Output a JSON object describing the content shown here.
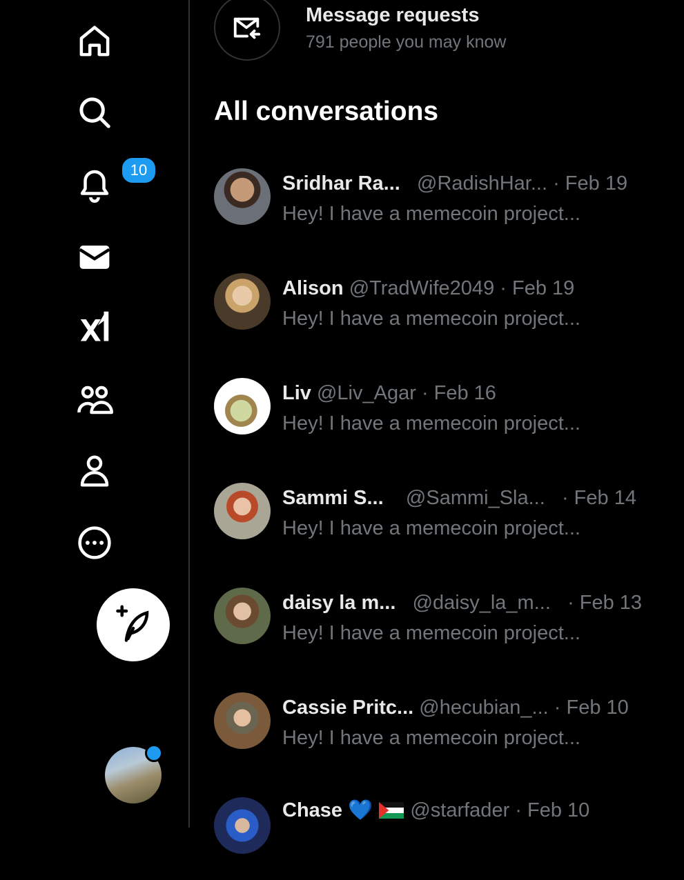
{
  "notifications_badge": "10",
  "message_requests": {
    "title": "Message requests",
    "subtitle": "791 people you may know"
  },
  "section_title": "All conversations",
  "conversations": [
    {
      "name": "Sridhar Ra...",
      "handle": "@RadishHar...",
      "date": "· Feb 19",
      "preview": "Hey! I have a memecoin project..."
    },
    {
      "name": "Alison",
      "handle": "@TradWife2049",
      "date": "· Feb 19",
      "preview": "Hey! I have a memecoin project..."
    },
    {
      "name": "Liv",
      "handle": "@Liv_Agar",
      "date": "· Feb 16",
      "preview": "Hey! I have a memecoin project..."
    },
    {
      "name": "Sammi S...",
      "handle": "@Sammi_Sla...",
      "date": "· Feb 14",
      "preview": "Hey! I have a memecoin project..."
    },
    {
      "name": "daisy la m...",
      "handle": "@daisy_la_m...",
      "date": "· Feb 13",
      "preview": "Hey! I have a memecoin project..."
    },
    {
      "name": "Cassie Pritc...",
      "handle": "@hecubian_...",
      "date": "· Feb 10",
      "preview": "Hey! I have a memecoin project..."
    },
    {
      "name": "Chase",
      "name_emoji": "💙",
      "handle": "@starfader",
      "date": "· Feb 10",
      "preview": ""
    }
  ],
  "icons": [
    "home-icon",
    "search-icon",
    "bell-icon",
    "mail-icon",
    "grok-icon",
    "communities-icon",
    "profile-icon",
    "more-icon",
    "compose-icon",
    "message-request-icon"
  ],
  "colors": {
    "accent": "#1d9bf0",
    "muted": "#71767b",
    "text": "#e7e9ea",
    "background": "#000000"
  }
}
